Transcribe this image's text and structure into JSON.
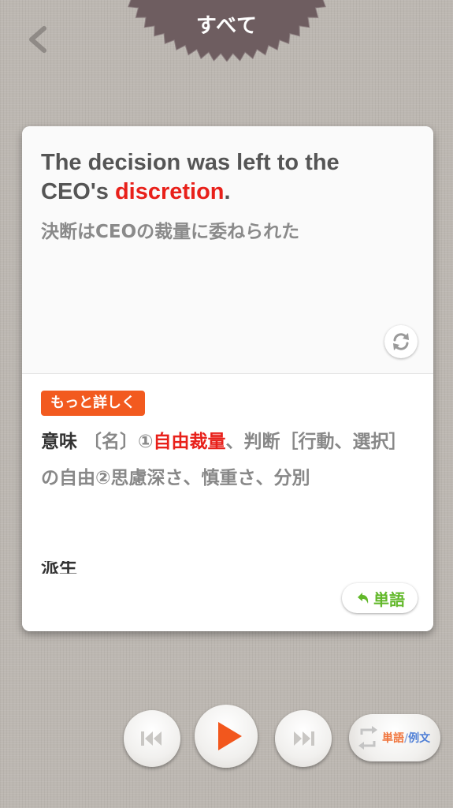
{
  "header": {
    "title": "すべて"
  },
  "card": {
    "sentence_before": "The decision was left to the CEO's ",
    "sentence_highlight": "discretion",
    "sentence_after": ".",
    "translation": "決断はCEOの裁量に委ねられた",
    "more_label": "もっと詳しく",
    "meaning_label": "意味",
    "meaning_pos": "〔名〕",
    "meaning_num1": "①",
    "meaning_highlight": "自由裁量",
    "meaning_rest": "、判断［行動、選択］の自由②思慮深さ、慎重さ、分別",
    "derivation_label": "派生",
    "word_button_label": "単語"
  },
  "controls": {
    "mode_word": "単語",
    "mode_sep": "/",
    "mode_sentence": "例文"
  },
  "colors": {
    "accent_red": "#e8201a",
    "badge_orange": "#f25a1f",
    "word_green": "#62b82a",
    "seal_color": "#6e5d60"
  }
}
